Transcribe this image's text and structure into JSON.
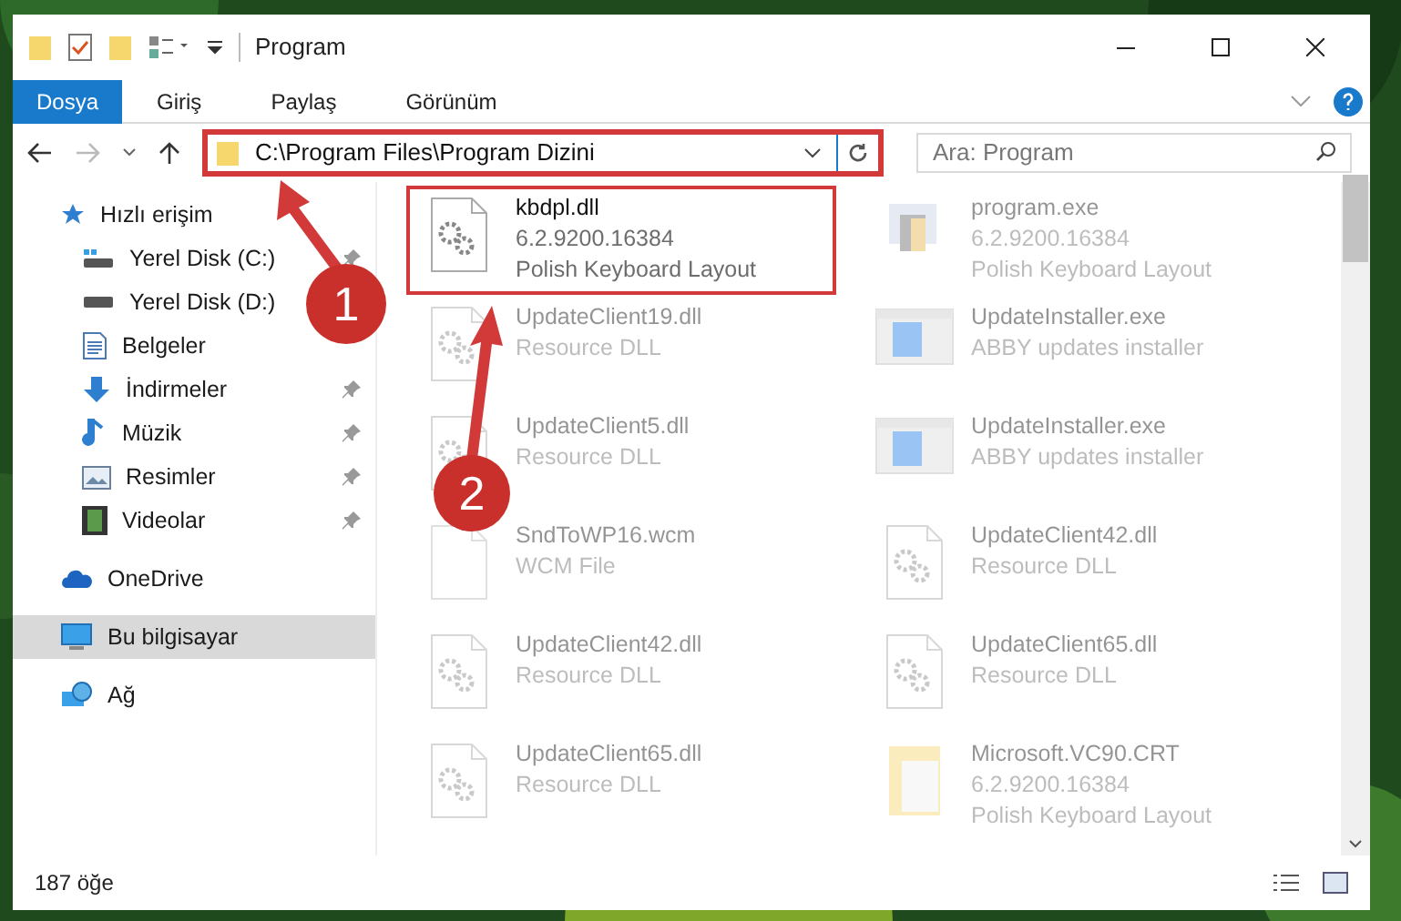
{
  "window": {
    "title": "Program"
  },
  "ribbon_tabs": [
    {
      "label": "Dosya",
      "selected": true
    },
    {
      "label": "Giriş",
      "selected": false
    },
    {
      "label": "Paylaş",
      "selected": false
    },
    {
      "label": "Görünüm",
      "selected": false
    }
  ],
  "address": {
    "path": "C:\\Program Files\\Program Dizini",
    "highlighted": true
  },
  "search": {
    "placeholder": "Ara: Program"
  },
  "sidebar": [
    {
      "label": "Hızlı erişim",
      "kind": "star",
      "selected": false,
      "children": [
        {
          "label": "Yerel Disk (C:)",
          "kind": "drive-c",
          "pinned": true
        },
        {
          "label": "Yerel Disk (D:)",
          "kind": "drive"
        },
        {
          "label": "Belgeler",
          "kind": "docs"
        },
        {
          "label": "İndirmeler",
          "kind": "download",
          "pinned": true
        },
        {
          "label": "Müzik",
          "kind": "music",
          "pinned": true
        },
        {
          "label": "Resimler",
          "kind": "pictures",
          "pinned": true
        },
        {
          "label": "Videolar",
          "kind": "video",
          "pinned": true
        }
      ]
    },
    {
      "label": "OneDrive",
      "kind": "cloud",
      "selected": false
    },
    {
      "label": "Bu bilgisayar",
      "kind": "pc",
      "selected": true
    },
    {
      "label": "Ağ",
      "kind": "network",
      "selected": false
    }
  ],
  "files": [
    {
      "kind": "dll",
      "name": "kbdpl.dll",
      "details": [
        "6.2.9200.16384",
        "Polish Keyboard Layout"
      ],
      "faded": false,
      "highlighted": true
    },
    {
      "kind": "exe",
      "name": "program.exe",
      "details": [
        "6.2.9200.16384",
        "Polish Keyboard Layout"
      ],
      "faded": true,
      "highlighted": false
    },
    {
      "kind": "dll",
      "name": "UpdateClient19.dll",
      "details": [
        "Resource DLL"
      ],
      "faded": true,
      "highlighted": false
    },
    {
      "kind": "installer",
      "name": "UpdateInstaller.exe",
      "details": [
        "ABBY updates installer"
      ],
      "faded": true,
      "highlighted": false
    },
    {
      "kind": "dll",
      "name": "UpdateClient5.dll",
      "details": [
        "Resource DLL"
      ],
      "faded": true,
      "highlighted": false
    },
    {
      "kind": "installer",
      "name": "UpdateInstaller.exe",
      "details": [
        "ABBY updates installer"
      ],
      "faded": true,
      "highlighted": false
    },
    {
      "kind": "blank",
      "name": "SndToWP16.wcm",
      "details": [
        "WCM File"
      ],
      "faded": true,
      "highlighted": false
    },
    {
      "kind": "dll",
      "name": "UpdateClient42.dll",
      "details": [
        "Resource DLL"
      ],
      "faded": true,
      "highlighted": false
    },
    {
      "kind": "dll",
      "name": "UpdateClient42.dll",
      "details": [
        "Resource DLL"
      ],
      "faded": true,
      "highlighted": false
    },
    {
      "kind": "dll",
      "name": "UpdateClient65.dll",
      "details": [
        "Resource DLL"
      ],
      "faded": true,
      "highlighted": false
    },
    {
      "kind": "dll",
      "name": "UpdateClient65.dll",
      "details": [
        "Resource DLL"
      ],
      "faded": true,
      "highlighted": false
    },
    {
      "kind": "folder",
      "name": "Microsoft.VC90.CRT",
      "details": [
        "6.2.9200.16384",
        "Polish Keyboard Layout"
      ],
      "faded": true,
      "highlighted": false
    }
  ],
  "status_bar": {
    "count": "187 öğe"
  },
  "annotations": [
    {
      "label": "1"
    },
    {
      "label": "2"
    }
  ]
}
